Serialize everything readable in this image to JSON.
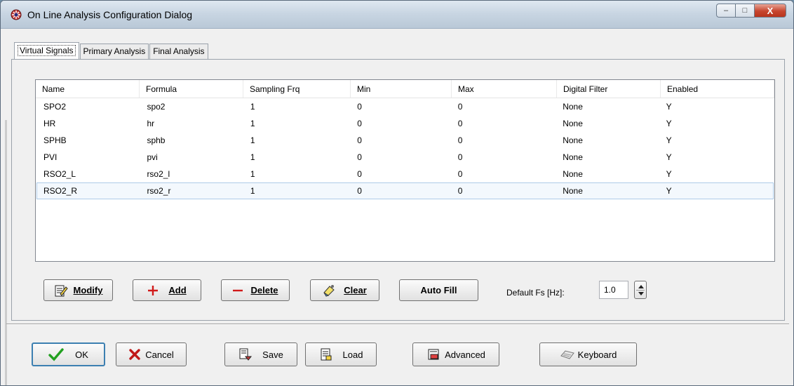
{
  "window": {
    "title": "On Line Analysis Configuration Dialog",
    "controls": {
      "minimize": "–",
      "maximize": "□",
      "close": "X"
    }
  },
  "tabs": [
    {
      "label": "Virtual Signals",
      "active": true
    },
    {
      "label": "Primary Analysis",
      "active": false
    },
    {
      "label": "Final Analysis",
      "active": false
    }
  ],
  "table": {
    "columns": [
      "Name",
      "Formula",
      "Sampling Frq",
      "Min",
      "Max",
      "Digital Filter",
      "Enabled"
    ],
    "rows": [
      [
        "SPO2",
        "spo2",
        "1",
        "0",
        "0",
        "None",
        "Y"
      ],
      [
        "HR",
        "hr",
        "1",
        "0",
        "0",
        "None",
        "Y"
      ],
      [
        "SPHB",
        "sphb",
        "1",
        "0",
        "0",
        "None",
        "Y"
      ],
      [
        "PVI",
        "pvi",
        "1",
        "0",
        "0",
        "None",
        "Y"
      ],
      [
        "RSO2_L",
        "rso2_l",
        "1",
        "0",
        "0",
        "None",
        "Y"
      ],
      [
        "RSO2_R",
        "rso2_r",
        "1",
        "0",
        "0",
        "None",
        "Y"
      ]
    ],
    "selected_row": 5
  },
  "actions": {
    "modify": {
      "label": "Modify",
      "icon": "edit-document-icon"
    },
    "add": {
      "label": "Add",
      "icon": "plus-icon",
      "color": "#d11a1a"
    },
    "delete": {
      "label": "Delete",
      "icon": "minus-icon",
      "color": "#d11a1a"
    },
    "clear": {
      "label": "Clear",
      "icon": "eraser-icon"
    },
    "autofill": {
      "label": "Auto Fill"
    }
  },
  "default_fs": {
    "label": "Default Fs [Hz]:",
    "value": "1.0"
  },
  "footer": {
    "ok": {
      "label": "OK",
      "icon": "checkmark-icon",
      "color": "#22a020"
    },
    "cancel": {
      "label": "Cancel",
      "icon": "x-icon",
      "color": "#c01818"
    },
    "save": {
      "label": "Save",
      "icon": "save-icon"
    },
    "load": {
      "label": "Load",
      "icon": "load-icon"
    },
    "advanced": {
      "label": "Advanced",
      "icon": "advanced-icon"
    },
    "keyboard": {
      "label": "Keyboard",
      "icon": "keyboard-icon"
    }
  }
}
